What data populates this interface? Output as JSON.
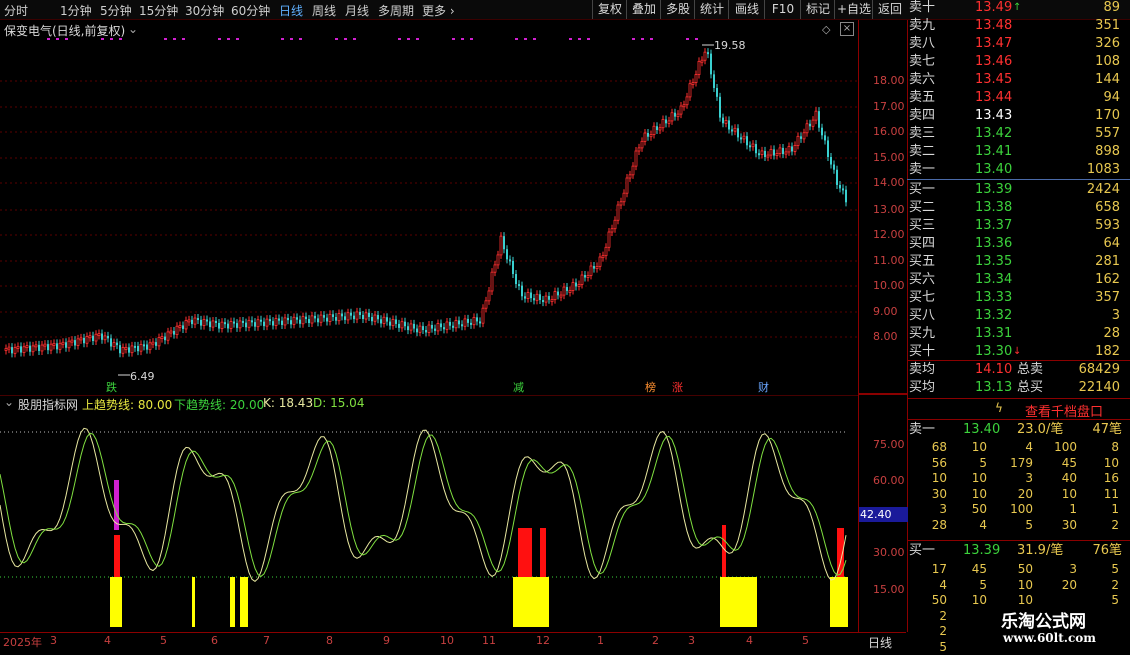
{
  "toolbar": {
    "periods": [
      "分时",
      "1分钟",
      "5分钟",
      "15分钟",
      "30分钟",
      "60分钟",
      "日线",
      "周线",
      "月线",
      "多周期",
      "更多"
    ],
    "active_period": "日线",
    "right_buttons": [
      "复权",
      "叠加",
      "多股",
      "统计",
      "画线",
      "F10",
      "标记",
      "+自选",
      "返回"
    ]
  },
  "main": {
    "title": "保变电气(日线,前复权)",
    "high_label": "19.58",
    "low_label": "6.49",
    "event_markers": [
      "跌",
      "减",
      "榜",
      "涨",
      "财"
    ],
    "price_ticks": [
      "18.00",
      "17.00",
      "16.00",
      "15.00",
      "14.00",
      "13.00",
      "12.00",
      "11.00",
      "10.00",
      "9.00",
      "8.00"
    ]
  },
  "indicator": {
    "name": "股朋指标网",
    "up_label": "上趋势线: 80.00",
    "down_label": "下趋势线: 20.00",
    "k_label": "K: 18.43",
    "d_label": "D: 15.04",
    "ticks": [
      "75.00",
      "60.00",
      "30.00",
      "15.00"
    ],
    "current": "42.40"
  },
  "bottom": {
    "year_label": "2025年",
    "dates": [
      "3",
      "4",
      "5",
      "6",
      "7",
      "8",
      "9",
      "10",
      "11",
      "12",
      "1",
      "2",
      "3",
      "4",
      "5"
    ],
    "period_label": "日线"
  },
  "orderbook": {
    "asks": [
      {
        "label": "卖十",
        "price": "13.49",
        "vol": "89"
      },
      {
        "label": "卖九",
        "price": "13.48",
        "vol": "351"
      },
      {
        "label": "卖八",
        "price": "13.47",
        "vol": "326"
      },
      {
        "label": "卖七",
        "price": "13.46",
        "vol": "108"
      },
      {
        "label": "卖六",
        "price": "13.45",
        "vol": "144"
      },
      {
        "label": "卖五",
        "price": "13.44",
        "vol": "94"
      },
      {
        "label": "卖四",
        "price": "13.43",
        "vol": "170"
      },
      {
        "label": "卖三",
        "price": "13.42",
        "vol": "557"
      },
      {
        "label": "卖二",
        "price": "13.41",
        "vol": "898"
      },
      {
        "label": "卖一",
        "price": "13.40",
        "vol": "1083"
      }
    ],
    "bids": [
      {
        "label": "买一",
        "price": "13.39",
        "vol": "2424"
      },
      {
        "label": "买二",
        "price": "13.38",
        "vol": "658"
      },
      {
        "label": "买三",
        "price": "13.37",
        "vol": "593"
      },
      {
        "label": "买四",
        "price": "13.36",
        "vol": "64"
      },
      {
        "label": "买五",
        "price": "13.35",
        "vol": "281"
      },
      {
        "label": "买六",
        "price": "13.34",
        "vol": "162"
      },
      {
        "label": "买七",
        "price": "13.33",
        "vol": "357"
      },
      {
        "label": "买八",
        "price": "13.32",
        "vol": "3"
      },
      {
        "label": "买九",
        "price": "13.31",
        "vol": "28"
      },
      {
        "label": "买十",
        "price": "13.30",
        "vol": "182"
      }
    ],
    "sell_avg_label": "卖均",
    "sell_avg": "14.10",
    "total_sell_label": "总卖",
    "total_sell": "68429",
    "buy_avg_label": "买均",
    "buy_avg": "13.13",
    "total_buy_label": "总买",
    "total_buy": "22140",
    "view_button": "查看千档盘口",
    "ask1_summary": {
      "label": "卖一",
      "price": "13.40",
      "per": "23.0/笔",
      "count": "47笔"
    },
    "ask1_grid": [
      [
        "68",
        "10",
        "4",
        "100",
        "8"
      ],
      [
        "56",
        "5",
        "179",
        "45",
        "10"
      ],
      [
        "10",
        "10",
        "3",
        "40",
        "16"
      ],
      [
        "30",
        "10",
        "20",
        "10",
        "11"
      ],
      [
        "3",
        "50",
        "100",
        "1",
        "1"
      ],
      [
        "28",
        "4",
        "5",
        "30",
        "2"
      ]
    ],
    "bid1_summary": {
      "label": "买一",
      "price": "13.39",
      "per": "31.9/笔",
      "count": "76笔"
    },
    "bid1_grid": [
      [
        "17",
        "45",
        "50",
        "3",
        "5"
      ],
      [
        "4",
        "5",
        "10",
        "20",
        "2"
      ],
      [
        "50",
        "10",
        "10",
        "",
        "5"
      ],
      [
        "2",
        "",
        "",
        "",
        ""
      ],
      [
        "2",
        "",
        "",
        "",
        ""
      ],
      [
        "5",
        "",
        "",
        "",
        ""
      ]
    ]
  },
  "watermark": {
    "name": "乐淘公式网",
    "url": "www.60lt.com"
  }
}
